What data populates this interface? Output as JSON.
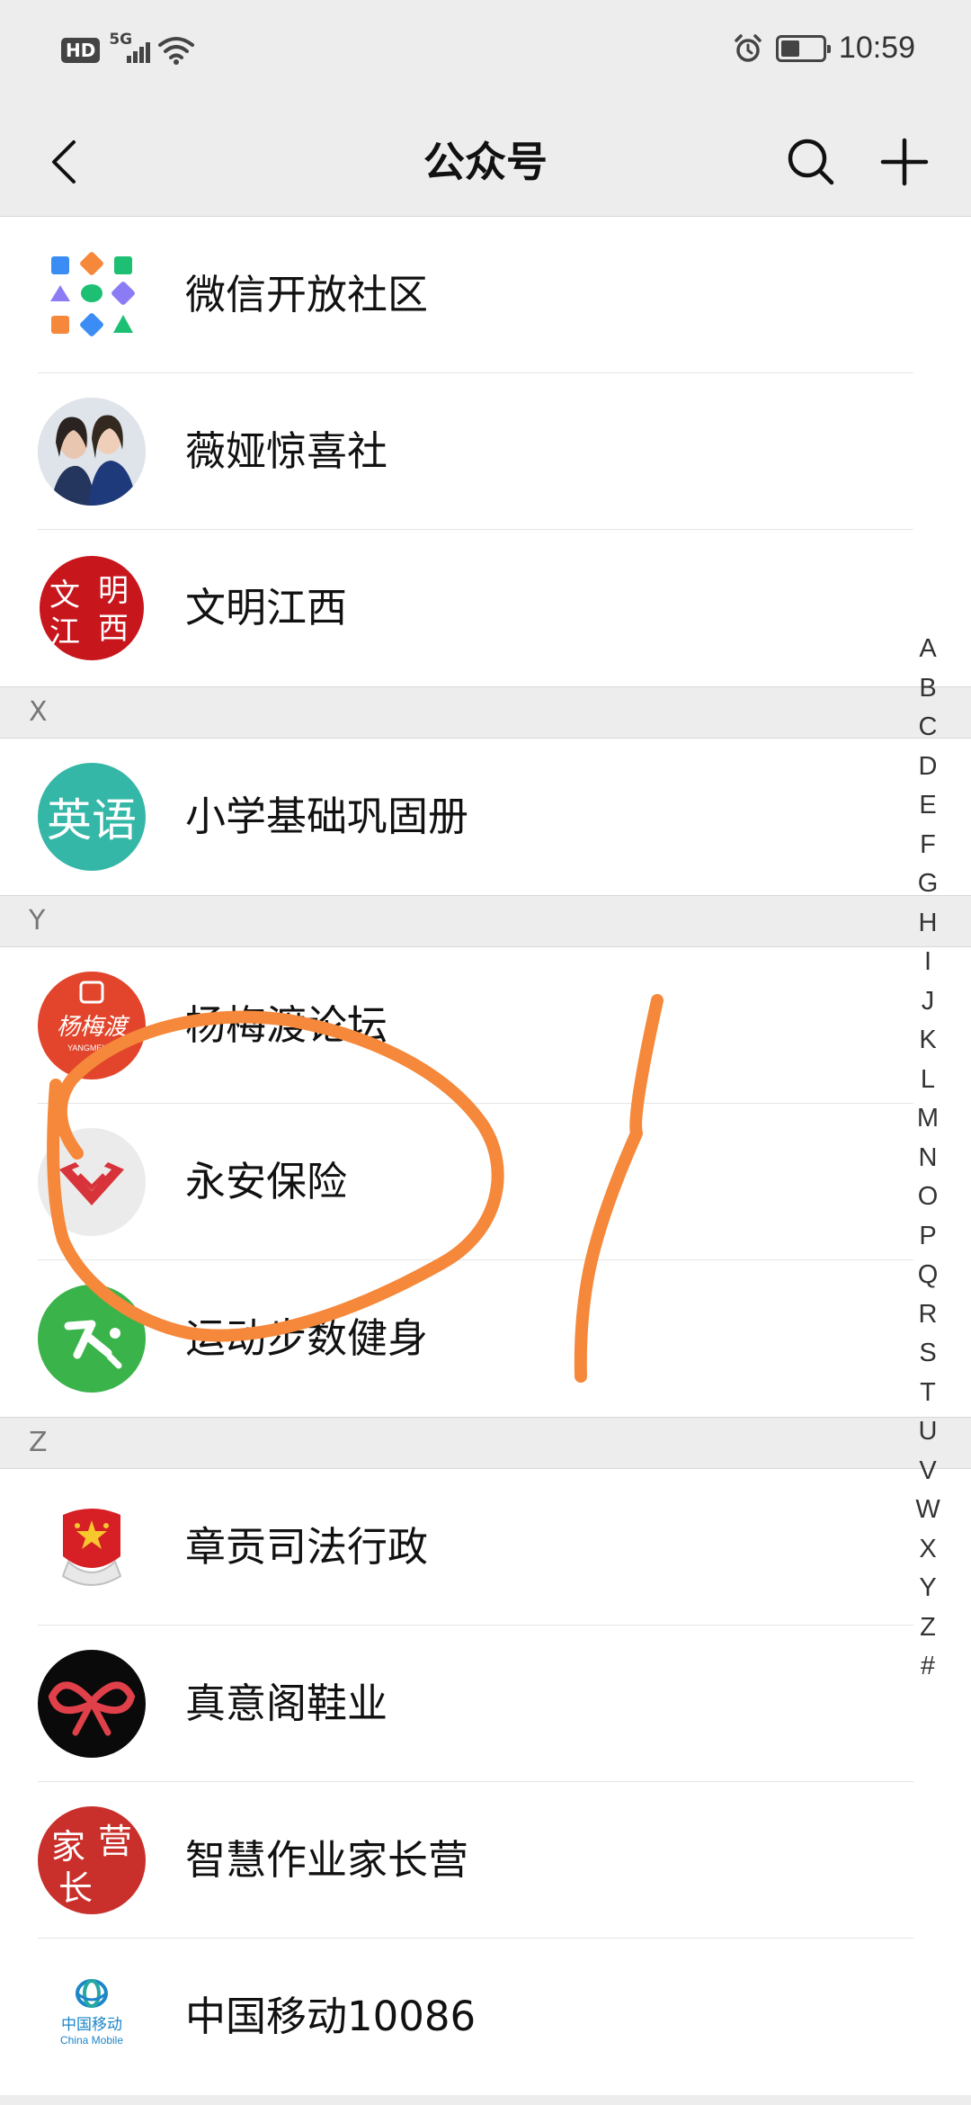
{
  "status_bar": {
    "hd": "HD",
    "network": "5G",
    "time": "10:59",
    "battery_level": 0.45
  },
  "nav": {
    "title": "公众号",
    "back_icon": "chevron-left-icon",
    "search_icon": "search-icon",
    "add_icon": "plus-icon"
  },
  "rows": {
    "r0": {
      "name": "微信开放社区"
    },
    "r1": {
      "name": "薇娅惊喜社"
    },
    "r2": {
      "name": "文明江西",
      "avatar_text": [
        "文",
        "明",
        "江",
        "西"
      ]
    },
    "r3": {
      "name": "小学基础巩固册",
      "avatar_text": "英语"
    },
    "r4": {
      "name": "杨梅渡论坛",
      "avatar_text": "杨梅渡",
      "avatar_subtext": "YANGMEIDU"
    },
    "r5": {
      "name": "永安保险"
    },
    "r6": {
      "name": "运动步数健身"
    },
    "r7": {
      "name": "章贡司法行政"
    },
    "r8": {
      "name": "真意阁鞋业"
    },
    "r9": {
      "name": "智慧作业家长营",
      "avatar_text": [
        "家",
        "营",
        "长"
      ]
    },
    "r10": {
      "name": "中国移动10086",
      "avatar_text": "中国移动",
      "avatar_subtext": "China Mobile"
    }
  },
  "sections": {
    "x": "X",
    "y": "Y",
    "z": "Z"
  },
  "index": [
    "A",
    "B",
    "C",
    "D",
    "E",
    "F",
    "G",
    "H",
    "I",
    "J",
    "K",
    "L",
    "M",
    "N",
    "O",
    "P",
    "Q",
    "R",
    "S",
    "T",
    "U",
    "V",
    "W",
    "X",
    "Y",
    "Z",
    "#"
  ],
  "colors": {
    "annotation": "#f5883a",
    "background": "#ededed",
    "section_text": "#777777"
  }
}
